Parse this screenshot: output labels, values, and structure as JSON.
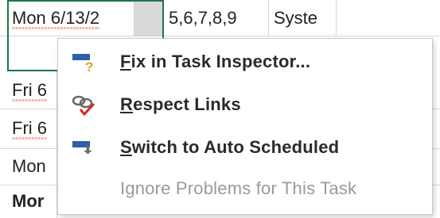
{
  "grid": {
    "rows": [
      {
        "cells": [
          "Mon 6/13/2",
          "",
          "5,6,7,8,9",
          "Syste"
        ]
      },
      {
        "cells": [
          "Fri 6"
        ]
      },
      {
        "cells": [
          "Fri 6"
        ]
      },
      {
        "cells": [
          "Mon"
        ]
      },
      {
        "cells": [
          "Mor"
        ]
      }
    ]
  },
  "context_menu": {
    "items": [
      {
        "accel": "F",
        "rest": "ix in Task Inspector...",
        "icon": "task-inspector-icon",
        "enabled": true
      },
      {
        "accel": "R",
        "rest": "espect Links",
        "icon": "respect-links-icon",
        "enabled": true
      },
      {
        "accel": "S",
        "rest": "witch to Auto Scheduled",
        "icon": "auto-schedule-icon",
        "enabled": true
      },
      {
        "pre": "I",
        "accel": "g",
        "rest": "nore Problems for This Task",
        "icon": "",
        "enabled": false
      }
    ]
  },
  "colors": {
    "selection": "#217346",
    "squiggle": "#e02020",
    "icon_blue": "#2e5fa8",
    "icon_gold": "#e0a020",
    "icon_red": "#d62828"
  }
}
